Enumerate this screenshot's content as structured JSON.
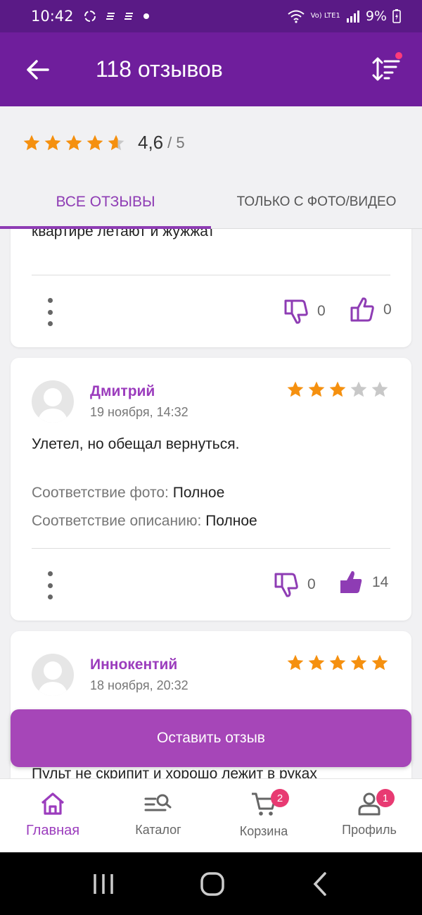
{
  "status_bar": {
    "time": "10:42",
    "battery": "9%",
    "network": "Vo) LTE1"
  },
  "header": {
    "title": "118 отзывов"
  },
  "rating": {
    "value": "4,6",
    "max": "/ 5",
    "stars_filled": 4.6
  },
  "tabs": [
    {
      "label": "ВСЕ ОТЗЫВЫ",
      "active": true
    },
    {
      "label": "ТОЛЬКО С ФОТО/ВИДЕО",
      "active": false
    }
  ],
  "reviews": [
    {
      "text_tail": "квартире летают и жужжат",
      "dislikes": "0",
      "likes": "0"
    },
    {
      "author": "Дмитрий",
      "date": "19 ноября, 14:32",
      "stars": 3,
      "text": "Улетел, но обещал вернуться.",
      "photo_match_label": "Соответствие фото:",
      "photo_match_value": "Полное",
      "desc_match_label": "Соответствие описанию:",
      "desc_match_value": "Полное",
      "dislikes": "0",
      "likes": "14"
    },
    {
      "author": "Иннокентий",
      "date": "18 ноября, 20:32",
      "stars": 5,
      "text": "Пульт не скрипит и хорошо лежит в руках"
    }
  ],
  "leave_review_button": "Оставить отзыв",
  "bottom_nav": [
    {
      "label": "Главная",
      "icon": "home-icon",
      "active": true
    },
    {
      "label": "Каталог",
      "icon": "catalog-search-icon",
      "active": false
    },
    {
      "label": "Корзина",
      "icon": "cart-icon",
      "badge": "2",
      "active": false
    },
    {
      "label": "Профиль",
      "icon": "profile-icon",
      "badge": "1",
      "active": false
    }
  ],
  "colors": {
    "status_bar": "#5a1a86",
    "app_bar": "#6f1e9c",
    "accent": "#9b3cbd",
    "button": "#a646b8",
    "star": "#f5900f",
    "badge": "#e83a72"
  }
}
